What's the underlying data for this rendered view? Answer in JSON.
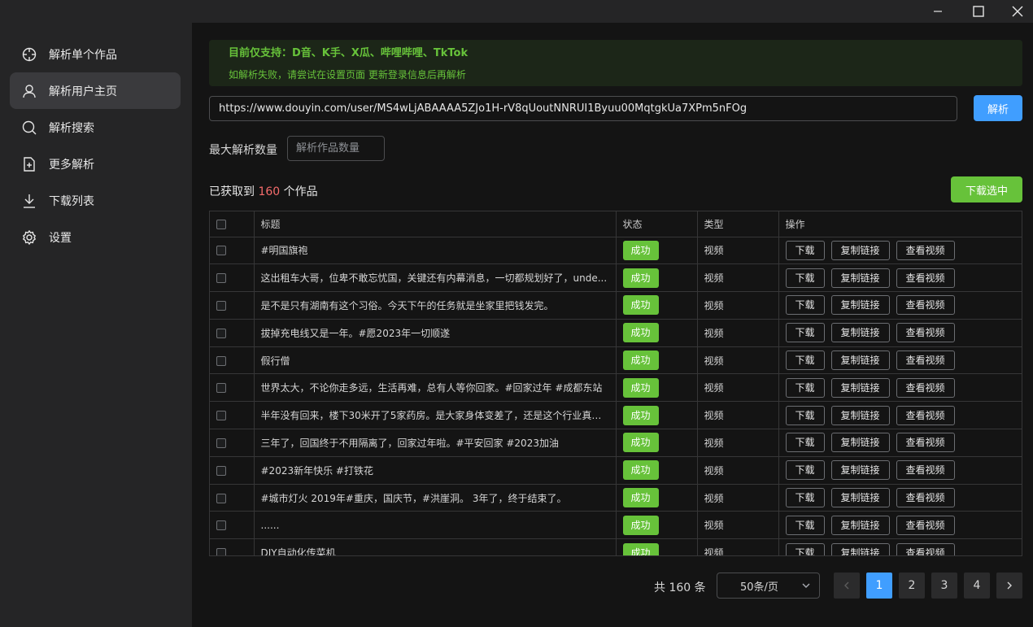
{
  "window": {
    "minimize_icon": "minimize-icon",
    "maximize_icon": "maximize-icon",
    "close_icon": "close-icon"
  },
  "sidebar": {
    "items": [
      {
        "label": "解析单个作品",
        "icon": "crosshair-icon",
        "active": false
      },
      {
        "label": "解析用户主页",
        "icon": "user-icon",
        "active": true
      },
      {
        "label": "解析搜索",
        "icon": "search-icon",
        "active": false
      },
      {
        "label": "更多解析",
        "icon": "file-add-icon",
        "active": false
      },
      {
        "label": "下载列表",
        "icon": "download-icon",
        "active": false
      },
      {
        "label": "设置",
        "icon": "gear-icon",
        "active": false
      }
    ]
  },
  "notice": {
    "line1": "目前仅支持：D音、K手、X瓜、哔哩哔哩、TkTok",
    "line2": "如解析失败，请尝试在设置页面 更新登录信息后再解析"
  },
  "url_input": {
    "value": "https://www.douyin.com/user/MS4wLjABAAAA5ZJo1H-rV8qUoutNNRUI1Byuu00MqtgkUa7XPm5nFOg"
  },
  "parse_button": "解析",
  "limit": {
    "label": "最大解析数量",
    "placeholder": "解析作品数量"
  },
  "result": {
    "prefix": "已获取到",
    "count": "160",
    "suffix": "个作品"
  },
  "download_selected": "下载选中",
  "table": {
    "headers": {
      "title": "标题",
      "status": "状态",
      "type": "类型",
      "actions": "操作"
    },
    "action_labels": {
      "download": "下载",
      "copy": "复制链接",
      "view": "查看视频"
    },
    "rows": [
      {
        "title": "#明国旗袍",
        "status": "成功",
        "type": "视频"
      },
      {
        "title": "这出租车大哥，位卑不敢忘忧国，关键还有内幕消息，一切都规划好了，unde...",
        "status": "成功",
        "type": "视频"
      },
      {
        "title": "是不是只有湖南有这个习俗。今天下午的任务就是坐家里把钱发完。",
        "status": "成功",
        "type": "视频"
      },
      {
        "title": "拔掉充电线又是一年。#愿2023年一切顺遂",
        "status": "成功",
        "type": "视频"
      },
      {
        "title": "假行僧",
        "status": "成功",
        "type": "视频"
      },
      {
        "title": "世界太大，不论你走多远，生活再难，总有人等你回家。#回家过年 #成都东站",
        "status": "成功",
        "type": "视频"
      },
      {
        "title": "半年没有回来，楼下30米开了5家药房。是大家身体变差了，还是这个行业真的...",
        "status": "成功",
        "type": "视频"
      },
      {
        "title": "三年了，回国终于不用隔离了，回家过年啦。#平安回家 #2023加油",
        "status": "成功",
        "type": "视频"
      },
      {
        "title": "#2023新年快乐 #打铁花",
        "status": "成功",
        "type": "视频"
      },
      {
        "title": "#城市灯火 2019年#重庆，国庆节，#洪崖洞。 3年了，终于结束了。",
        "status": "成功",
        "type": "视频"
      },
      {
        "title": "......",
        "status": "成功",
        "type": "视频"
      },
      {
        "title": "DIY自动化传菜机",
        "status": "成功",
        "type": "视频"
      }
    ]
  },
  "pagination": {
    "total": "共 160 条",
    "page_size": "50条/页",
    "pages": [
      "1",
      "2",
      "3",
      "4"
    ],
    "current": "1"
  }
}
